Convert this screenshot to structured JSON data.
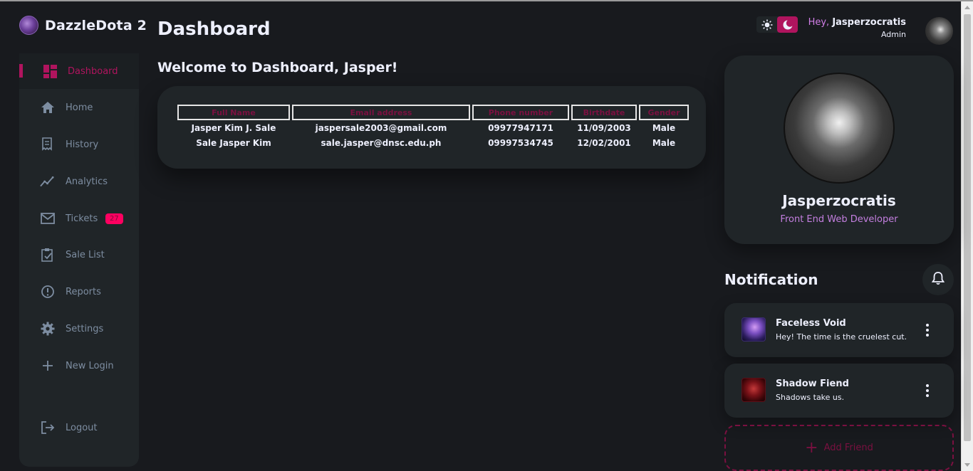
{
  "app": {
    "name": "DazzleDota 2"
  },
  "sidebar": {
    "items": [
      {
        "label": "Dashboard",
        "icon": "grid-icon",
        "active": true
      },
      {
        "label": "Home",
        "icon": "home-icon"
      },
      {
        "label": "History",
        "icon": "receipt-icon"
      },
      {
        "label": "Analytics",
        "icon": "analytics-icon"
      },
      {
        "label": "Tickets",
        "icon": "mail-icon",
        "badge": "27"
      },
      {
        "label": "Sale List",
        "icon": "clipboard-check-icon"
      },
      {
        "label": "Reports",
        "icon": "alert-circle-icon"
      },
      {
        "label": "Settings",
        "icon": "gear-icon"
      },
      {
        "label": "New Login",
        "icon": "plus-icon"
      },
      {
        "label": "Logout",
        "icon": "logout-icon"
      }
    ]
  },
  "main": {
    "title": "Dashboard",
    "welcome": "Welcome to Dashboard, Jasper!",
    "table": {
      "headers": [
        "Full Name",
        "Email address",
        "Phone number",
        "Birthdate",
        "Gender"
      ],
      "rows": [
        [
          "Jasper Kim J. Sale",
          "jaspersale2003@gmail.com",
          "09977947171",
          "11/09/2003",
          "Male"
        ],
        [
          "Sale Jasper Kim",
          "sale.jasper@dnsc.edu.ph",
          "09997534745",
          "12/02/2001",
          "Male"
        ]
      ]
    }
  },
  "header": {
    "greeting": "Hey,",
    "username": "Jasperzocratis",
    "role": "Admin"
  },
  "profile": {
    "name": "Jasperzocratis",
    "job": "Front End Web Developer"
  },
  "notifications": {
    "title": "Notification",
    "items": [
      {
        "title": "Faceless Void",
        "message": "Hey! The time is the cruelest cut."
      },
      {
        "title": "Shadow Fiend",
        "message": "Shadows take us."
      }
    ],
    "add_label": "Add Friend"
  },
  "colors": {
    "primary": "#b0145e",
    "badge": "#ff0060",
    "background": "#181a1e",
    "card": "#202528",
    "accent_text": "#c47fe0"
  }
}
